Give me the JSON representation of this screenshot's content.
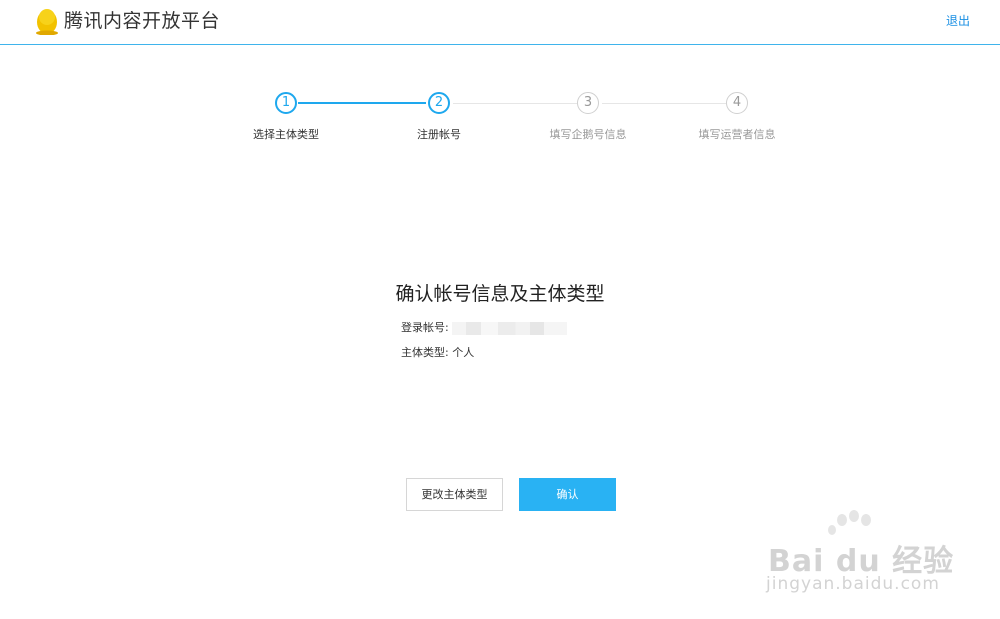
{
  "header": {
    "brand": "腾讯内容开放平台",
    "logout": "退出",
    "logo_icon": "penguin-icon",
    "accent_color": "#3fb4ec"
  },
  "steps": [
    {
      "number": "1",
      "label": "选择主体类型",
      "state": "active"
    },
    {
      "number": "2",
      "label": "注册帐号",
      "state": "active"
    },
    {
      "number": "3",
      "label": "填写企鹅号信息",
      "state": "inactive"
    },
    {
      "number": "4",
      "label": "填写运营者信息",
      "state": "inactive"
    }
  ],
  "main": {
    "title": "确认帐号信息及主体类型",
    "account_label": "登录帐号:",
    "type_label": "主体类型:",
    "type_value": "个人"
  },
  "buttons": {
    "change": "更改主体类型",
    "confirm": "确认"
  },
  "watermark": {
    "text": "Bai du 经验",
    "url": "jingyan.baidu.com"
  }
}
